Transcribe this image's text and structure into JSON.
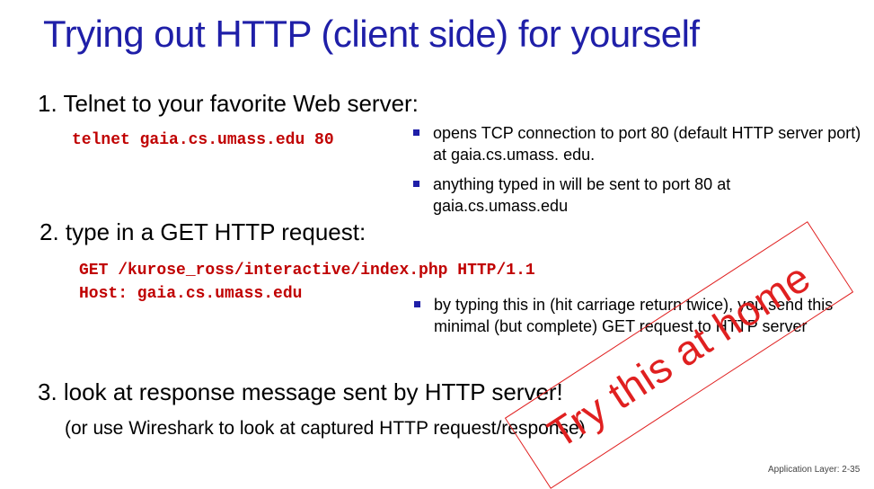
{
  "slide": {
    "title": "Trying out HTTP (client side) for yourself",
    "footer": "Application Layer: 2-35"
  },
  "steps": [
    {
      "heading": "1. Telnet to your favorite Web server:",
      "code": [
        "telnet gaia.cs.umass.edu 80"
      ],
      "bullets": [
        "opens TCP connection to port 80 (default HTTP server port)  at gaia.cs.umass. edu.",
        "anything typed in will be sent  to port 80 at gaia.cs.umass.edu"
      ]
    },
    {
      "heading": "2. type in a GET HTTP request:",
      "code": [
        "GET /kurose_ross/interactive/index.php HTTP/1.1",
        "Host: gaia.cs.umass.edu"
      ],
      "bullets": [
        "by typing this in (hit carriage return twice), you send this minimal (but complete)  GET request to HTTP server"
      ]
    },
    {
      "heading": "3. look at response message sent by HTTP server!",
      "note": "(or use Wireshark to look at captured HTTP request/response)"
    }
  ],
  "stamp": {
    "text": "Try this at home",
    "color": "#e02020"
  },
  "colors": {
    "title": "#1f1fa8",
    "code": "#c00000",
    "bullet_marker": "#1f1fa8"
  }
}
